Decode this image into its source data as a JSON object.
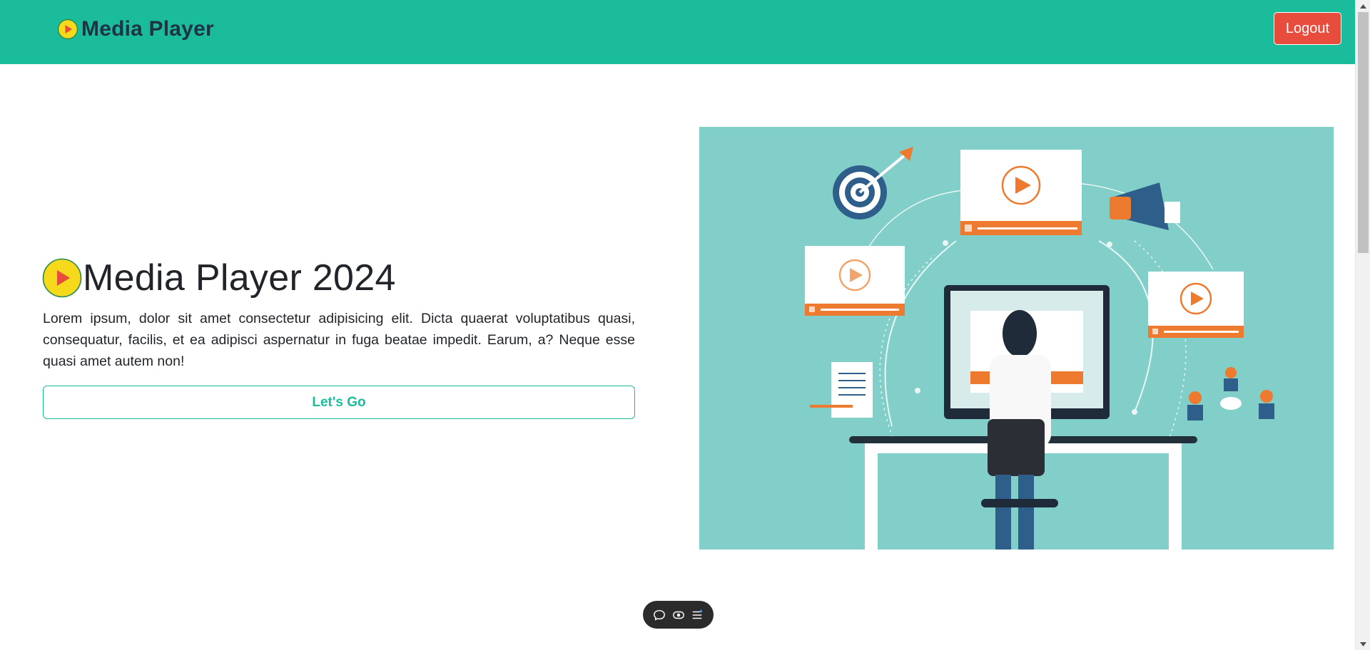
{
  "navbar": {
    "brand_text": "Media Player",
    "logout_label": "Logout"
  },
  "hero": {
    "title": "Media Player 2024",
    "description": "Lorem ipsum, dolor sit amet consectetur adipisicing elit. Dicta quaerat voluptatibus quasi, consequatur, facilis, et ea adipisci aspernatur in fuga beatae impedit. Earum, a? Neque esse quasi amet autem non!",
    "cta_label": "Let's Go"
  },
  "illustration": {
    "icon_name": "video-marketing-illustration"
  },
  "floating_toolbar": {
    "items": [
      "comment-icon",
      "eye-icon",
      "menu-list-icon"
    ]
  },
  "colors": {
    "primary": "#1abc9c",
    "danger": "#e74c3c",
    "brand_text": "#1f3347",
    "play_icon_yellow": "#f6d91a",
    "play_icon_red": "#e74c3c",
    "illustration_bg": "#82cec8",
    "accent_orange": "#ee7a2f"
  }
}
